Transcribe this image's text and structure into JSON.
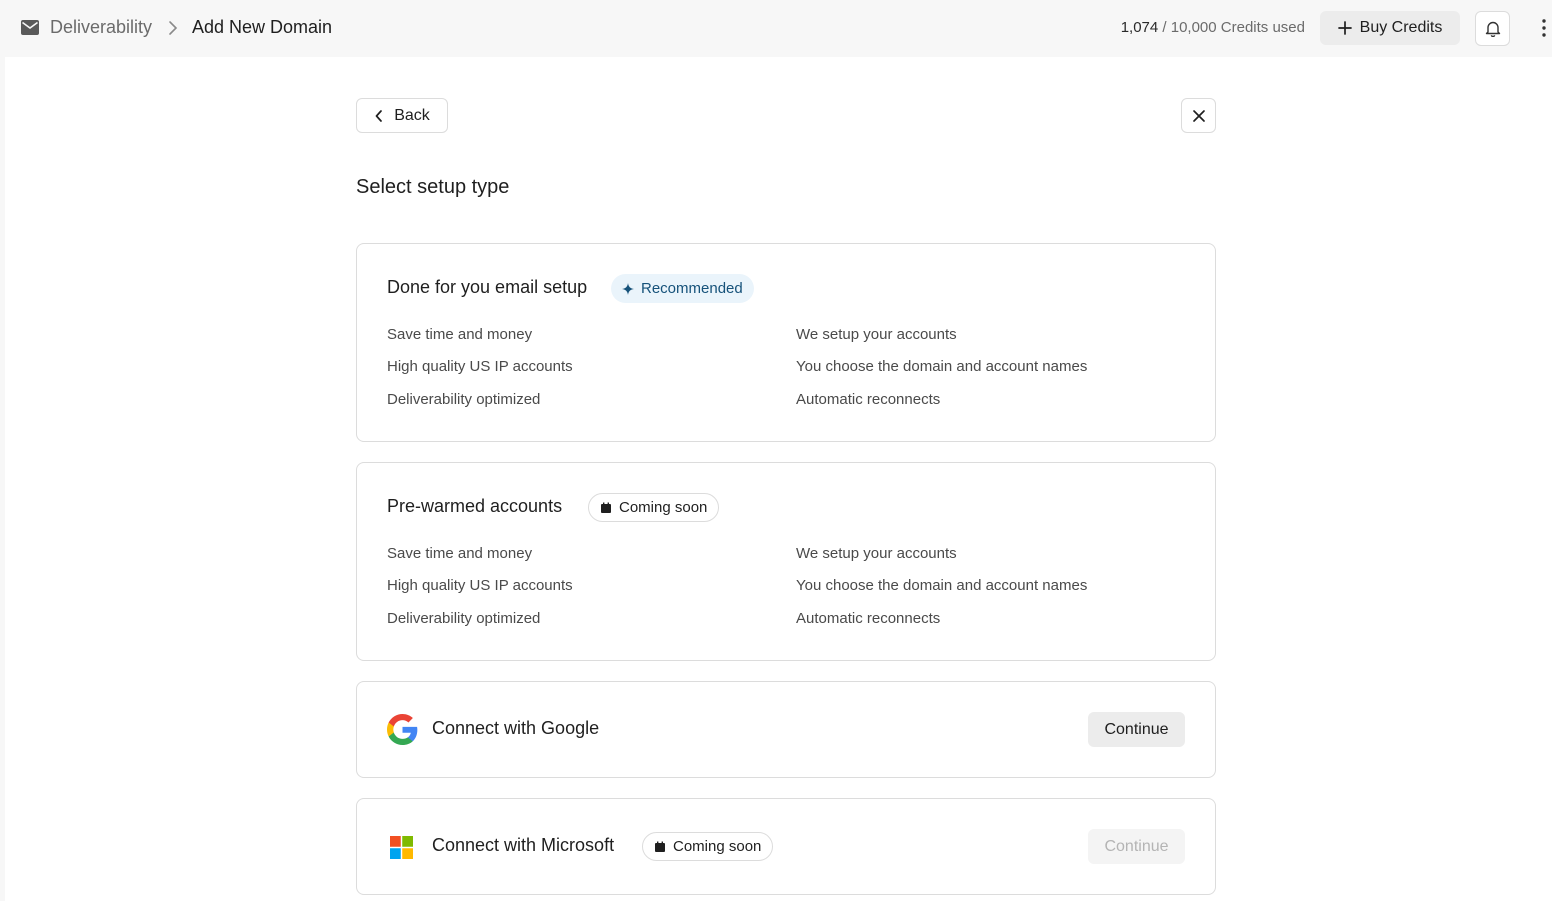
{
  "topbar": {
    "breadcrumb": [
      "Deliverability",
      "Add New Domain"
    ],
    "credits_used": "1,074",
    "credits_total": "/ 10,000 Credits used",
    "buy_label": "Buy Credits"
  },
  "icons": {
    "breadcrumb": "mail-icon",
    "separator": "chevron-right-icon",
    "buy": "plus-icon",
    "notifications": "bell-icon",
    "more": "more-vertical-icon",
    "back": "chevron-left-icon",
    "close": "close-icon",
    "recommended": "sparkle-icon",
    "coming_soon": "calendar-icon",
    "google": "google-logo-icon",
    "microsoft": "microsoft-logo-icon"
  },
  "main": {
    "back_label": "Back",
    "title": "Select setup type"
  },
  "options": [
    {
      "title": "Done for you email setup",
      "badge": "Recommended",
      "features_left": [
        "Save time and money",
        "High quality US IP accounts",
        "Deliverability optimized"
      ],
      "features_right": [
        "We setup your accounts",
        "You choose the domain and account names",
        "Automatic reconnects"
      ]
    },
    {
      "title": "Pre-warmed accounts",
      "badge": "Coming soon",
      "features_left": [
        "Save time and money",
        "High quality US IP accounts",
        "Deliverability optimized"
      ],
      "features_right": [
        "We setup your accounts",
        "You choose the domain and account names",
        "Automatic reconnects"
      ]
    }
  ],
  "connections": [
    {
      "title": "Connect with Google",
      "button": "Continue",
      "enabled": true
    },
    {
      "title": "Connect with Microsoft",
      "badge": "Coming soon",
      "button": "Continue",
      "enabled": false
    }
  ],
  "colors": {
    "recommended_bg": "#eaf4fb",
    "recommended_text": "#16527a",
    "google_blue": "#4285F4",
    "google_red": "#EA4335",
    "google_yellow": "#FBBC05",
    "google_green": "#34A853",
    "ms_red": "#F25022",
    "ms_green": "#7FBA00",
    "ms_blue": "#00A4EF",
    "ms_yellow": "#FFB900"
  }
}
